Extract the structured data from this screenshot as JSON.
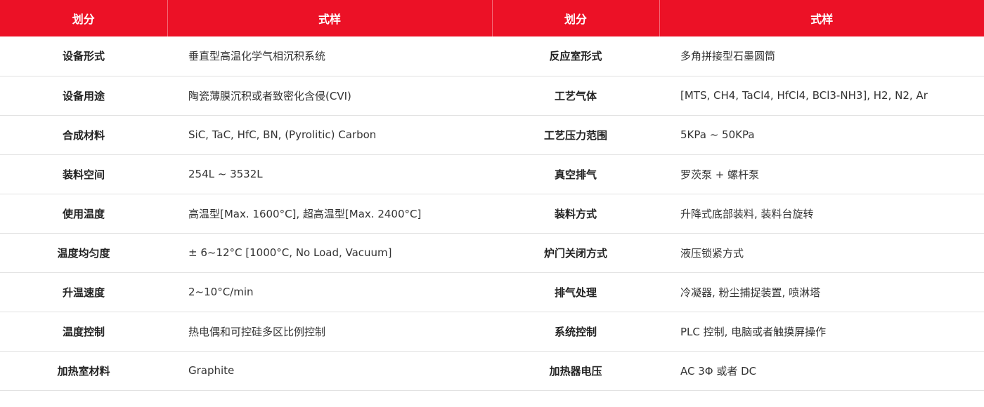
{
  "header": {
    "col1": "划分",
    "col2": "式样",
    "col3": "划分",
    "col4": "式样"
  },
  "rows": [
    {
      "left_label": "设备形式",
      "left_value": "垂直型高温化学气相沉积系统",
      "right_label": "反应室形式",
      "right_value": "多角拼接型石墨圆筒"
    },
    {
      "left_label": "设备用途",
      "left_value": "陶瓷薄膜沉积或者致密化含侵(CVI)",
      "right_label": "工艺气体",
      "right_value": "[MTS, CH4, TaCl4, HfCl4, BCl3-NH3], H2, N2, Ar"
    },
    {
      "left_label": "合成材料",
      "left_value": "SiC, TaC, HfC, BN, (Pyrolitic) Carbon",
      "right_label": "工艺压力范围",
      "right_value": "5KPa ~ 50KPa"
    },
    {
      "left_label": "装料空间",
      "left_value": "254L ~ 3532L",
      "right_label": "真空排气",
      "right_value": "罗茨泵 + 螺杆泵"
    },
    {
      "left_label": "使用温度",
      "left_value": "高温型[Max. 1600°C], 超高温型[Max. 2400°C]",
      "right_label": "装料方式",
      "right_value": "升降式底部装料, 装料台旋转"
    },
    {
      "left_label": "温度均匀度",
      "left_value": "± 6~12°C [1000°C, No Load, Vacuum]",
      "right_label": "炉门关闭方式",
      "right_value": "液压锁紧方式"
    },
    {
      "left_label": "升温速度",
      "left_value": "2~10°C/min",
      "right_label": "排气处理",
      "right_value": "冷凝器, 粉尘捕捉装置, 喷淋塔"
    },
    {
      "left_label": "温度控制",
      "left_value": "热电偶和可控硅多区比例控制",
      "right_label": "系统控制",
      "right_value": "PLC 控制, 电脑或者触摸屏操作"
    },
    {
      "left_label": "加热室材料",
      "left_value": "Graphite",
      "right_label": "加热器电压",
      "right_value": "AC 3Φ 或者 DC"
    }
  ]
}
